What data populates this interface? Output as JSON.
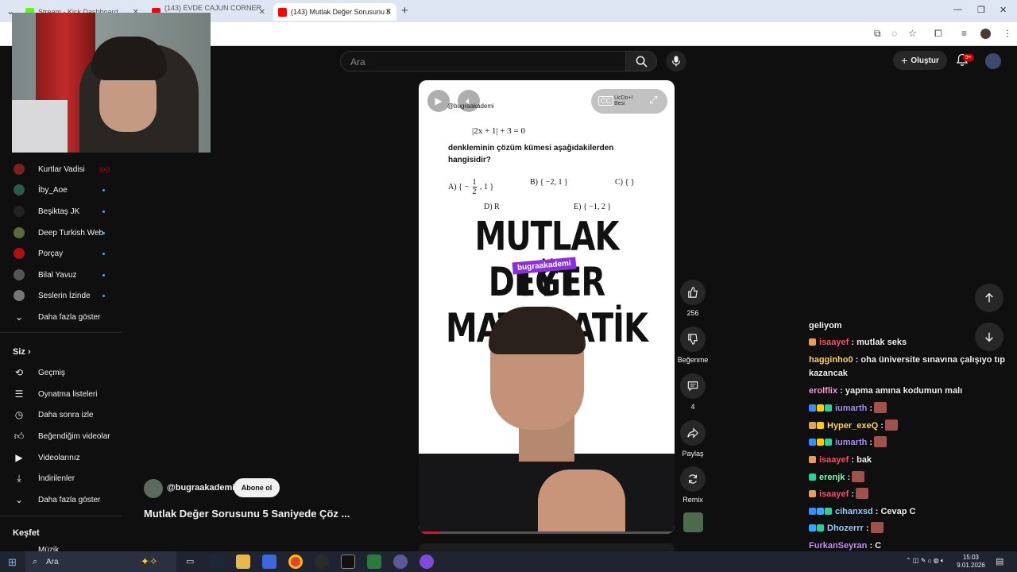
{
  "browser": {
    "tabs": [
      {
        "title": "Stream - Kick Dashboard",
        "color": "#53fc18"
      },
      {
        "title": "(143) EVDE CAJUN CORNER TA",
        "color": "#ff0000"
      },
      {
        "title": "(143) Mutlak Değer Sorusunu 5",
        "color": "#ff0000"
      }
    ],
    "new_tab": "+"
  },
  "header": {
    "search_placeholder": "Ara",
    "create_label": "Oluştur",
    "notif_count": "9+"
  },
  "sidebar": {
    "subscriptions": [
      {
        "label": "Kurtlar Vadisi",
        "color": "#7a2020",
        "live": true
      },
      {
        "label": "İby_Aoe",
        "color": "#2e5a4a"
      },
      {
        "label": "Beşiktaş JK",
        "color": "#222222"
      },
      {
        "label": "Deep Turkish Web",
        "color": "#5a6a3a"
      },
      {
        "label": "Porçay",
        "color": "#b01010"
      },
      {
        "label": "Bilal Yavuz",
        "color": "#555555"
      },
      {
        "label": "Seslerin İzinde",
        "color": "#777777"
      }
    ],
    "show_more_1": "Daha fazla göster",
    "you_header": "Siz",
    "you_items": [
      {
        "label": "Geçmiş",
        "icon": "history-icon"
      },
      {
        "label": "Oynatma listeleri",
        "icon": "playlist-icon"
      },
      {
        "label": "Daha sonra izle",
        "icon": "clock-icon"
      },
      {
        "label": "Beğendiğim videolar",
        "icon": "thumb-up-icon"
      },
      {
        "label": "Videolarınız",
        "icon": "video-icon"
      },
      {
        "label": "İndirilenler",
        "icon": "download-icon"
      }
    ],
    "show_more_2": "Daha fazla göster",
    "explore_header": "Keşfet",
    "explore_first": "Müzik"
  },
  "short": {
    "handle": "@bugraakademi",
    "overlay_text": "UcDo+I Besi",
    "equation": "|2x + 1| + 3 = 0",
    "question_line1": "denkleminin çözüm kümesi aşağıdakilerden",
    "question_line2": "hangisidir?",
    "opt_a_prefix": "A) { −",
    "opt_a_num": "1",
    "opt_a_den": "2",
    "opt_a_suffix": ", 1 }",
    "opt_b": "B) { −2, 1 }",
    "opt_c": "C) { }",
    "opt_d": "D) R",
    "opt_e": "E) { −1, 2 }",
    "title_line1": "MUTLAK DEĞER",
    "title_line2": "TYT MATEMATİK",
    "tag": "bugraakademi",
    "progress": 0.08
  },
  "actions": {
    "likes": "256",
    "dislike_label": "Beğenme",
    "comments": "4",
    "share_label": "Paylaş",
    "remix_label": "Remix"
  },
  "video": {
    "channel": "@bugraakademi",
    "subscribe_label": "Abone ol",
    "title": "Mutlak Değer Sorusunu 5 Saniyede Çöz ..."
  },
  "chat": [
    {
      "user": "",
      "msg": "geliyom",
      "color": "#ffffff",
      "badges": [],
      "emote": false
    },
    {
      "user": "isaayef",
      "msg": ": mutlak seks",
      "color": "#ff4f6d",
      "badges": [
        "#e0a060"
      ],
      "emote": false
    },
    {
      "user": "hagginho0",
      "msg": ": oha üniversite sınavına çalışıyo tıp kazancak",
      "color": "#ffd65a",
      "badges": [],
      "emote": false
    },
    {
      "user": "erolflix",
      "msg": ": yapma amına kodumun malı",
      "color": "#ff9ad8",
      "badges": [],
      "emote": false
    },
    {
      "user": "iumarth",
      "msg": ":",
      "color": "#a88bff",
      "badges": [
        "#3b8dff",
        "#ffcc00",
        "#33cc99"
      ],
      "emote": true
    },
    {
      "user": "Hyper_exeQ",
      "msg": ":",
      "color": "#ffd65a",
      "badges": [
        "#e0a060",
        "#ffcc00"
      ],
      "emote": true
    },
    {
      "user": "iumarth",
      "msg": ":",
      "color": "#a88bff",
      "badges": [
        "#3b8dff",
        "#ffcc00",
        "#33cc99"
      ],
      "emote": true
    },
    {
      "user": "isaayef",
      "msg": ": bak",
      "color": "#ff4f6d",
      "badges": [
        "#e0a060"
      ],
      "emote": false
    },
    {
      "user": "erenjk",
      "msg": ":",
      "color": "#7dffb0",
      "badges": [
        "#33cc99"
      ],
      "emote": true
    },
    {
      "user": "isaayef",
      "msg": ":",
      "color": "#ff4f6d",
      "badges": [
        "#e0a060"
      ],
      "emote": true
    },
    {
      "user": "cihanxsd",
      "msg": ": Cevap C",
      "color": "#9ad0ff",
      "badges": [
        "#3b8dff",
        "#33aaff",
        "#33cc99"
      ],
      "emote": false
    },
    {
      "user": "Dhozerrr",
      "msg": ":",
      "color": "#9ad0ff",
      "badges": [
        "#33aaff",
        "#33cc99"
      ],
      "emote": true
    },
    {
      "user": "FurkanSeyran",
      "msg": ": C",
      "color": "#c88bff",
      "badges": [],
      "emote": false
    },
    {
      "user": "Dhozerrr",
      "msg": ":",
      "color": "#9ad0ff",
      "badges": [
        "#33aaff"
      ],
      "emote": true
    }
  ],
  "taskbar": {
    "search": "Ara",
    "time": "15:03",
    "date": "9.01.2026"
  }
}
